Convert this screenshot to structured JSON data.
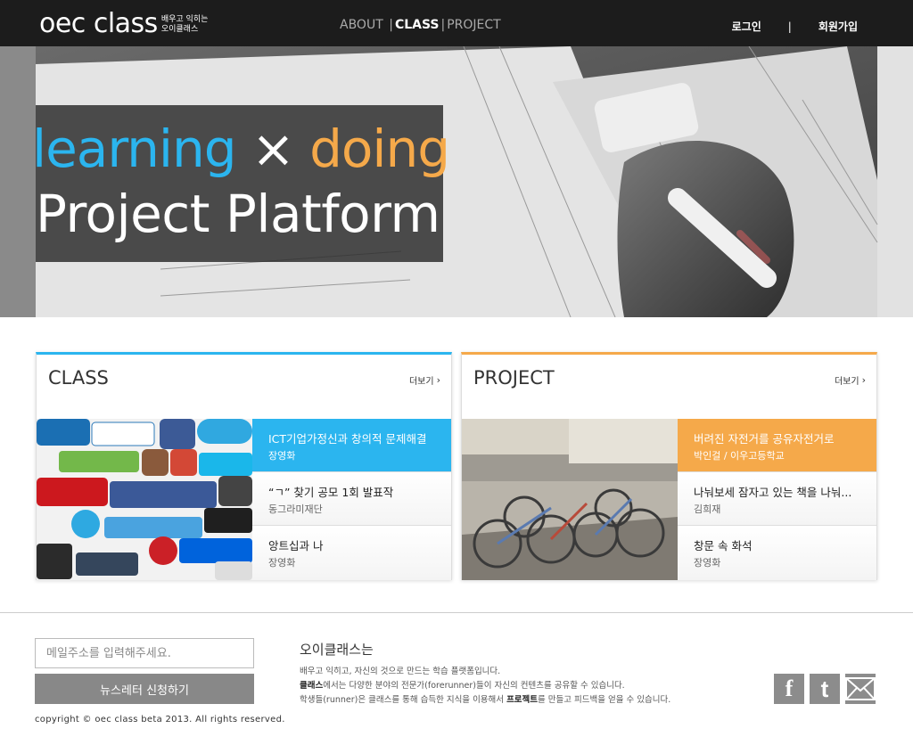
{
  "header": {
    "logo_main": "oec class",
    "logo_sub_line1": "배우고 익히는",
    "logo_sub_line2": "오이클래스",
    "nav": [
      "ABOUT",
      "CLASS",
      "PROJECT"
    ],
    "nav_active": "CLASS",
    "login": "로그인",
    "divider": "|",
    "signup": "회원가입"
  },
  "hero": {
    "word1": "learning",
    "times": "×",
    "word2": "doing",
    "line2": "Project Platform"
  },
  "class_panel": {
    "title": "CLASS",
    "more": "더보기",
    "items": [
      {
        "title": "ICT기업가정신과 창의적 문제해결",
        "subtitle": "장영화",
        "selected": true
      },
      {
        "title": "“ㄱ” 찾기 공모 1회 발표작",
        "subtitle": "동그라미재단",
        "selected": false
      },
      {
        "title": "앙트십과 나",
        "subtitle": "장영화",
        "selected": false
      }
    ]
  },
  "project_panel": {
    "title": "PROJECT",
    "more": "더보기",
    "items": [
      {
        "title": "버려진 자전거를 공유자전거로",
        "subtitle": "박인걸 / 이우고등학교",
        "selected": true
      },
      {
        "title": "나눠보세 잠자고 있는 책을 나눠...",
        "subtitle": "김희재",
        "selected": false
      },
      {
        "title": "창문 속 화석",
        "subtitle": "장영화",
        "selected": false
      }
    ]
  },
  "footer": {
    "email_placeholder": "메일주소를 입력해주세요.",
    "subscribe_label": "뉴스레터 신청하기",
    "copyright": "copyright © oec class beta 2013. All rights reserved.",
    "about_title": "오이클래스는",
    "about_line1": "배우고 익히고, 자신의 것으로 만드는 학습 플랫폼입니다.",
    "about_line2_bold": "클래스",
    "about_line2_rest": "에서는 다양한 분야의 전문가(forerunner)들이 자신의 컨텐츠를 공유할 수 있습니다.",
    "about_line3_a": "학생들(runner)은 클래스를 통해 습득한 지식을 이용해서 ",
    "about_line3_bold": "프로젝트",
    "about_line3_b": "를 만들고 피드백을 얻을 수 있습니다.",
    "social": [
      "facebook-icon",
      "tumblr-icon",
      "mail-icon"
    ]
  },
  "colors": {
    "blue": "#2bb5ef",
    "orange": "#f5a94a",
    "dark": "#1c1c1c"
  }
}
